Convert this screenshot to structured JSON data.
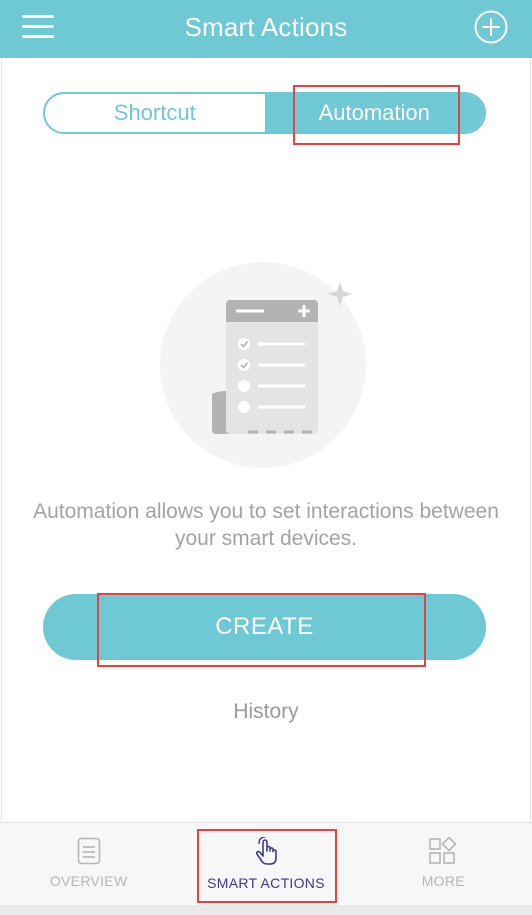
{
  "header": {
    "title": "Smart Actions"
  },
  "tabs": [
    {
      "label": "Shortcut",
      "active": false
    },
    {
      "label": "Automation",
      "active": true
    }
  ],
  "empty_state": {
    "description": "Automation allows you to set interactions between your smart devices."
  },
  "actions": {
    "create_label": "CREATE",
    "history_label": "History"
  },
  "bottom_nav": [
    {
      "label": "OVERVIEW",
      "icon": "document-icon",
      "active": false
    },
    {
      "label": "SMART ACTIONS",
      "icon": "hand-pointer-icon",
      "active": true
    },
    {
      "label": "MORE",
      "icon": "grid-icon",
      "active": false
    }
  ],
  "colors": {
    "accent": "#6ec9d5",
    "active_nav": "#3c3a8c",
    "highlight": "#e04444"
  }
}
